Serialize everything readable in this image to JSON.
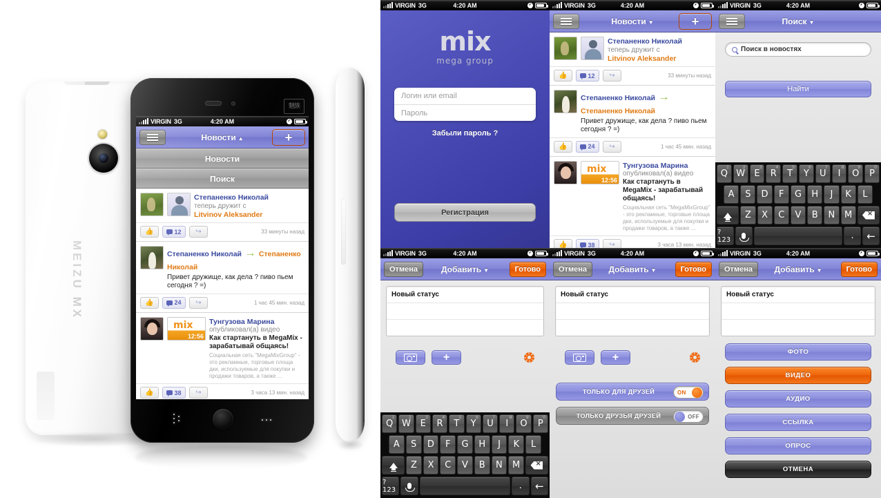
{
  "statusbar": {
    "carrier": "VIRGIN",
    "network": "3G",
    "time": "4:20 AM",
    "lock_icon": "lock-icon",
    "battery_icon": "battery-icon"
  },
  "device": {
    "brand": "MEIZU MX",
    "logo_glyph": "魅族"
  },
  "login": {
    "logo_word": "mix",
    "logo_sub": "mega group",
    "login_placeholder": "Логин или email",
    "password_placeholder": "Пароль",
    "forgot_label": "Забыли пароль ?",
    "register_label": "Регистрация"
  },
  "feed": {
    "nav": {
      "menu_icon": "list-icon",
      "title": "Новости",
      "caret_down": "▼",
      "caret_up": "▲",
      "add_icon": "plus-icon"
    },
    "dropdown": [
      {
        "label": "Новости"
      },
      {
        "label": "Поиск"
      }
    ],
    "posts": [
      {
        "author": "Степаненко Николай",
        "action": "теперь дружит с",
        "target": "Litvinov Aleksander",
        "likes_icon": "thumbs-up-icon",
        "comments": "12",
        "share_icon": "share-icon",
        "time": "33 минуты назад"
      },
      {
        "author": "Степаненко Николай",
        "arrow": "→",
        "target": "Степаненко Николай",
        "body": "Привет дружище, как дела ? пиво пьем сегодня ? =)",
        "likes_icon": "thumbs-up-icon",
        "comments": "24",
        "share_icon": "share-icon",
        "time": "1 час 45 мин. назад"
      },
      {
        "author": "Тунгузова Марина",
        "action": "опубликовал(а) видео",
        "title": "Как стартануть в MegaMix - зарабатывай общаясь!",
        "desc": "Социальная сеть \"MegaMixGroup\" - это рекламные, торговые площа дки, используемые для покупки и продажи товаров, а также ...",
        "video_duration": "12:56",
        "video_logo": "mix",
        "likes_icon": "thumbs-up-icon",
        "comments": "38",
        "share_icon": "share-icon",
        "time": "3 часа 13 мин. назад"
      }
    ],
    "gallery": [
      {
        "name": "photo-thumb-girl-field"
      },
      {
        "name": "photo-thumb-eyes-makeup"
      },
      {
        "name": "photo-thumb-horses-sunset"
      }
    ]
  },
  "search": {
    "nav_title": "Поиск",
    "caret": "▼",
    "menu_icon": "list-icon",
    "search_icon": "search-icon",
    "search_value": "Поиск в новостях",
    "find_label": "Найти"
  },
  "compose": {
    "cancel_label": "Отмена",
    "title": "Добавить",
    "caret": "▼",
    "done_label": "Готово",
    "status_placeholder": "Новый статус",
    "camera_icon": "camera-icon",
    "plus_icon": "plus-icon",
    "gear_icon": "gear-icon"
  },
  "privacy": {
    "rows": [
      {
        "label": "ТОЛЬКО ДЛЯ ДРУЗЕЙ",
        "state": "ON"
      },
      {
        "label": "ТОЛЬКО ДРУЗЬЯ ДРУЗЕЙ",
        "state": "OFF"
      }
    ]
  },
  "attach": {
    "buttons": [
      {
        "label": "ФОТО",
        "style": "violet"
      },
      {
        "label": "ВИДЕО",
        "style": "orange"
      },
      {
        "label": "АУДИО",
        "style": "violet"
      },
      {
        "label": "ССЫЛКА",
        "style": "violet"
      },
      {
        "label": "ОПРОС",
        "style": "violet"
      },
      {
        "label": "ОТМЕНА",
        "style": "dark"
      }
    ]
  },
  "keyboard": {
    "row1": [
      {
        "key": "Q",
        "num": "1"
      },
      {
        "key": "W",
        "num": "2"
      },
      {
        "key": "E",
        "num": "3"
      },
      {
        "key": "R",
        "num": "4"
      },
      {
        "key": "T",
        "num": "5"
      },
      {
        "key": "Y",
        "num": "6"
      },
      {
        "key": "U",
        "num": "7"
      },
      {
        "key": "I",
        "num": "8"
      },
      {
        "key": "O",
        "num": "9"
      },
      {
        "key": "P",
        "num": "0"
      }
    ],
    "row2": [
      "A",
      "S",
      "D",
      "F",
      "G",
      "H",
      "J",
      "K",
      "L"
    ],
    "row3": [
      "Z",
      "X",
      "C",
      "V",
      "B",
      "N",
      "M"
    ],
    "shift_icon": "shift-icon",
    "backspace_icon": "backspace-icon",
    "symbols_label": "?123",
    "mic_icon": "microphone-icon",
    "space_label": "",
    "period_label": ".",
    "enter_icon": "enter-icon"
  },
  "colors": {
    "nav_purple": "#8285d6",
    "accent_orange": "#ec5f06",
    "login_bg": "#4a4bb4",
    "name_blue": "#3b4a9e",
    "name_orange": "#e07a14"
  }
}
